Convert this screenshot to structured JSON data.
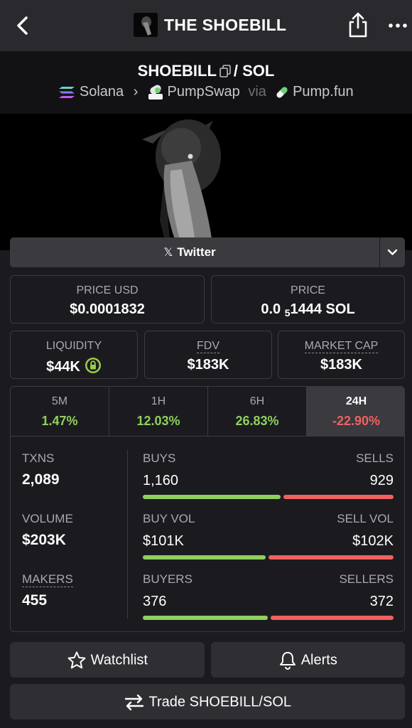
{
  "header": {
    "title": "THE SHOEBILL",
    "back_icon": "chevron-left-icon",
    "share_icon": "share-icon",
    "more_icon": "more-icon"
  },
  "pair": {
    "base": "SHOEBILL",
    "separator": "/ SOL",
    "chain": "Solana",
    "dex": "PumpSwap",
    "via": "via",
    "launchpad": "Pump.fun"
  },
  "socials": {
    "twitter_label": "Twitter",
    "x_glyph": "𝕏"
  },
  "prices": {
    "usd_label": "PRICE USD",
    "usd_value": "$0.0001832",
    "native_label": "PRICE",
    "native_prefix": "0.0",
    "native_zeros": "5",
    "native_digits": "1444 SOL"
  },
  "metrics": {
    "liquidity_label": "LIQUIDITY",
    "liquidity_value": "$44K",
    "fdv_label": "FDV",
    "fdv_value": "$183K",
    "mcap_label": "MARKET CAP",
    "mcap_value": "$183K"
  },
  "timeframes": [
    {
      "label": "5M",
      "change": "1.47%"
    },
    {
      "label": "1H",
      "change": "12.03%"
    },
    {
      "label": "6H",
      "change": "26.83%"
    },
    {
      "label": "24H",
      "change": "-22.90%"
    }
  ],
  "stats": {
    "txns_label": "TXNS",
    "txns_value": "2,089",
    "volume_label": "VOLUME",
    "volume_value": "$203K",
    "makers_label": "MAKERS",
    "makers_value": "455",
    "buys_label": "BUYS",
    "buys_value": "1,160",
    "sells_label": "SELLS",
    "sells_value": "929",
    "buys_ratio": 0.555,
    "buyvol_label": "BUY VOL",
    "buyvol_value": "$101K",
    "sellvol_label": "SELL VOL",
    "sellvol_value": "$102K",
    "vol_ratio": 0.497,
    "buyers_label": "BUYERS",
    "buyers_value": "376",
    "sellers_label": "SELLERS",
    "sellers_value": "372",
    "buyers_ratio": 0.503
  },
  "actions": {
    "watchlist_label": "Watchlist",
    "alerts_label": "Alerts",
    "trade_label": "Trade SHOEBILL/SOL"
  },
  "colors": {
    "positive": "#8fcf5f",
    "negative": "#f0615f",
    "background": "#1b1b1f",
    "accent_lock": "#9ccc4a"
  }
}
